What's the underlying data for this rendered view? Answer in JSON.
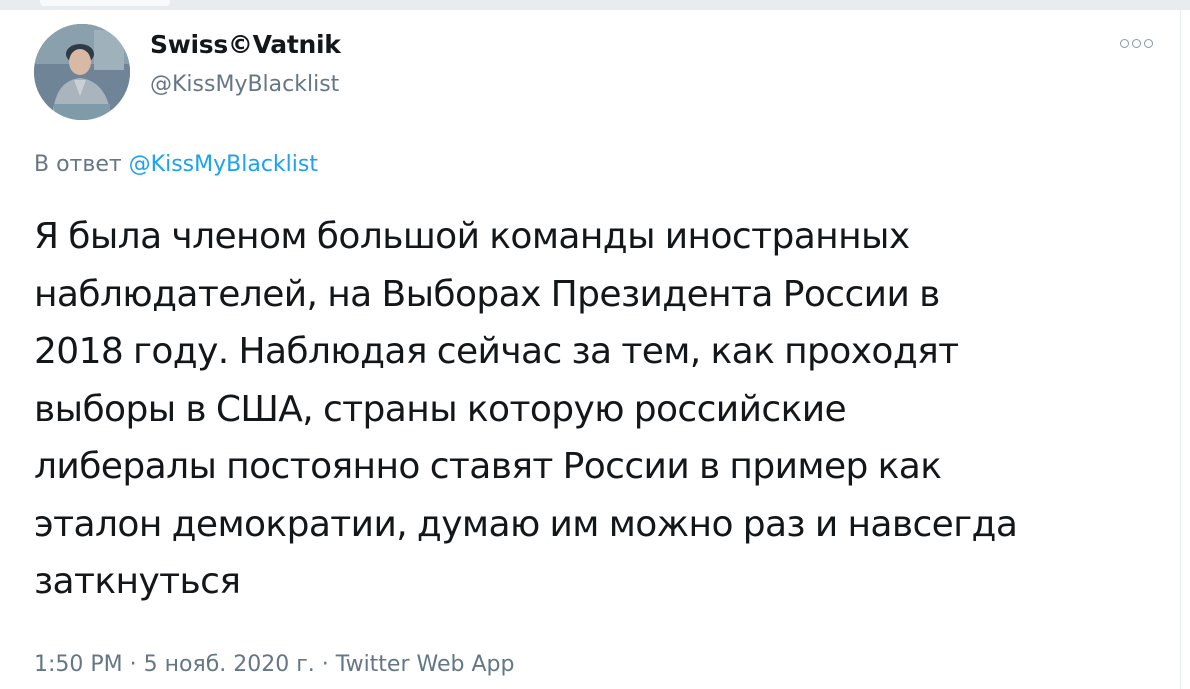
{
  "author": {
    "display_name": "Swiss©Vatnik",
    "username": "@KissMyBlacklist",
    "avatar_icon": "user-avatar"
  },
  "menu": {
    "more_icon": "more-options-icon"
  },
  "reply": {
    "prefix": "В ответ ",
    "mention": "@KissMyBlacklist"
  },
  "tweet": {
    "lines": [
      "Я была членом большой команды иностранных",
      "наблюдателей, на Выборах Президента России в",
      "2018 году. Наблюдая сейчас за тем, как проходят",
      "выборы в США, страны которую российские",
      "либералы постоянно ставят России в пример как",
      "эталон демократии, думаю им можно раз и навсегда",
      "заткнуться"
    ]
  },
  "meta": {
    "time": "1:50 PM",
    "separator": " · ",
    "date": "5 нояб. 2020 г.",
    "source": "Twitter Web App"
  },
  "colors": {
    "text": "#14171a",
    "secondary": "#657786",
    "link": "#1da1f2"
  }
}
